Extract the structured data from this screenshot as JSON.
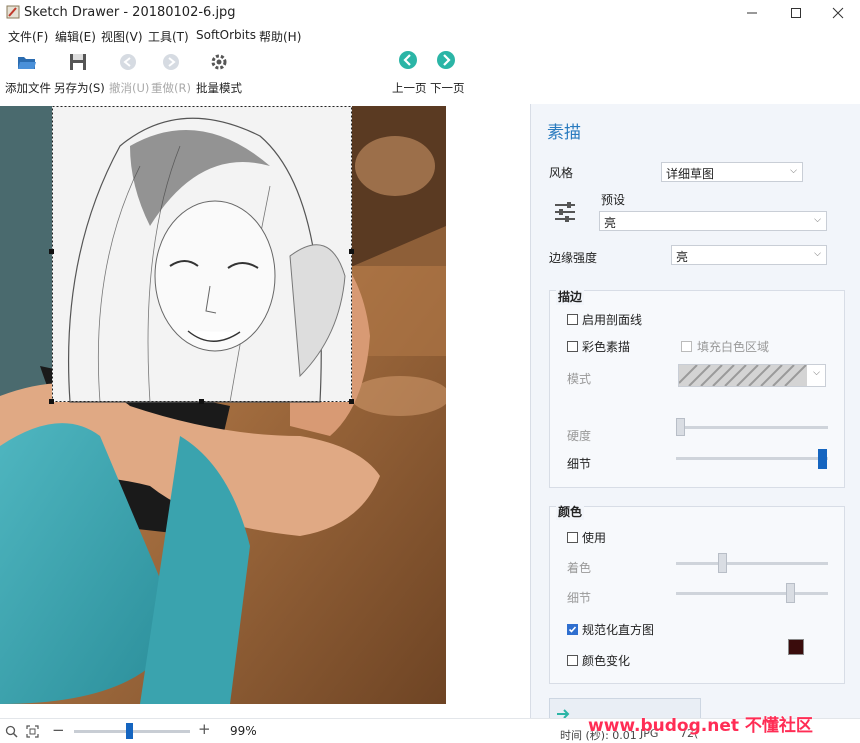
{
  "window": {
    "title": "Sketch Drawer - 20180102-6.jpg"
  },
  "menu": [
    "文件(F)",
    "编辑(E)",
    "视图(V)",
    "工具(T)",
    "SoftOrbits",
    "帮助(H)"
  ],
  "toolbar": {
    "add_file": "添加文件",
    "save_as": "另存为(S)",
    "undo": "撤消(U)",
    "redo": "重做(R)",
    "batch": "批量模式",
    "prev": "上一页",
    "next": "下一页"
  },
  "panel": {
    "title": "素描",
    "style_label": "风格",
    "style_value": "详细草图",
    "preset_label": "预设",
    "preset_value": "亮",
    "edge_label": "边缘强度",
    "edge_value": "亮",
    "stroke_group": {
      "title": "描边",
      "hatch": "启用剖面线",
      "color_sketch": "彩色素描",
      "fill_white": "填充白色区域",
      "pattern_label": "模式",
      "hardness_label": "硬度",
      "detail_label": "细节"
    },
    "color_group": {
      "title": "颜色",
      "use": "使用",
      "tint_label": "着色",
      "detail_label": "细节",
      "normalize": "规范化直方图",
      "color_change": "颜色变化"
    },
    "swatch_color": "#3a0c0c"
  },
  "status": {
    "zoom": "99%",
    "time": "时间 (秒): 0.01",
    "format": "JPG",
    "extra": "72("
  },
  "watermark": {
    "text": "www.budog.net 不懂社区"
  },
  "colors": {
    "accent": "#1565c0",
    "panel_title": "#2a7bbf",
    "nav_arrow": "#2bb5a6"
  }
}
